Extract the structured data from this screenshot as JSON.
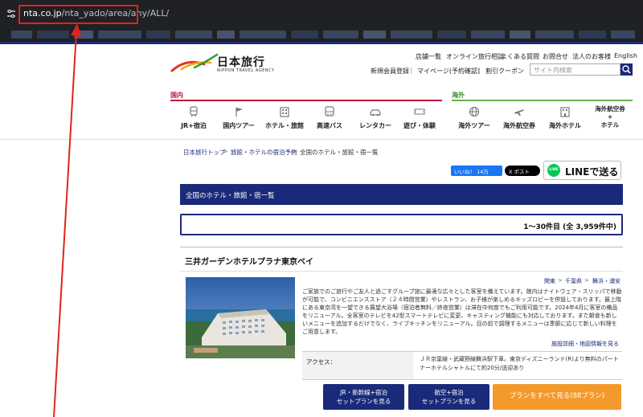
{
  "browser": {
    "url_host": "nta.co.jp",
    "url_path": "/nta_yado/area/any/ALL/"
  },
  "header": {
    "logo_title": "日本旅行",
    "logo_sub": "NIPPON TRAVEL AGENCY",
    "top_links": [
      "店舗一覧",
      "オンライン旅行相談",
      "よくある質問",
      "お問合せ",
      "法人のお客様",
      "English"
    ],
    "account_links": [
      "新規会員登録",
      "マイページ(予約確認)",
      "割引クーポン"
    ],
    "search_placeholder": "サイト内検索"
  },
  "nav": {
    "domestic_label": "国内",
    "overseas_label": "海外",
    "domestic_items": [
      "JR+宿泊",
      "国内ツアー",
      "ホテル・旅館",
      "高速バス",
      "レンタカー",
      "遊び・体験"
    ],
    "overseas_items": [
      "海外ツアー",
      "海外航空券",
      "海外ホテル",
      "海外航空券\n+\nホテル"
    ]
  },
  "breadcrumb": {
    "items": [
      "日本旅行トップ",
      "旅館・ホテルの宿泊予約",
      "全国のホテル・旅館・宿一覧"
    ],
    "separator": ">"
  },
  "social": {
    "fb_like": "いいね！ 14万",
    "x_post": "X ポスト",
    "line_badge": "LINE",
    "line_text": "LINEで送る"
  },
  "results": {
    "title": "全国のホテル・旅館・宿一覧",
    "count": "1〜30件目 (全 3,959件中)"
  },
  "hotel": {
    "name": "三井ガーデンホテルプラナ東京ベイ",
    "area": [
      "関東",
      "千葉県",
      "舞浜・浦安"
    ],
    "description": "ご家族でのご旅行やご友人と過ごすグループ旅に最適な広々とした客室を備えています。館内はナイトウェア・スリッパで移動が可能で、コンビニエンスストア（２４時間営業）やレストラン、お子様が楽しめるキッズロビーを併設しております。最上階にある東京湾を一望できる展望大浴場（宿泊者無料／終夜営業）は滞在中何度でもご利用可能です。2024年4月に客室の備品をリニューアル。全客室のテレビを42型スマートテレビに変更、キャスティング機能にも対応しております。また朝食も新しいメニューを追加するだけでなく、ライブキッチンをリニューアル。目の前で調理するメニューは季節に応じて新しい料理をご用意します。",
    "more_link": "施設詳細・地図情報を見る",
    "access_label": "アクセス：",
    "access_text": "ＪＲ京葉線・武蔵野線舞浜駅下車。東京ディズニーランド(R)より無料のパートナーホテルシャトルにて約20分/送迎あり",
    "btn_jr": "JR・新幹線+宿泊\nセットプランを見る",
    "btn_air": "航空+宿泊\nセットプランを見る",
    "btn_all": "プランをすべて見る(88プラン)"
  },
  "colors": {
    "navy": "#1a2a7a",
    "domestic_red": "#c0133a",
    "overseas_green": "#6ab04c",
    "plan_orange": "#f39a2c",
    "annotation_red": "#e0241b"
  }
}
